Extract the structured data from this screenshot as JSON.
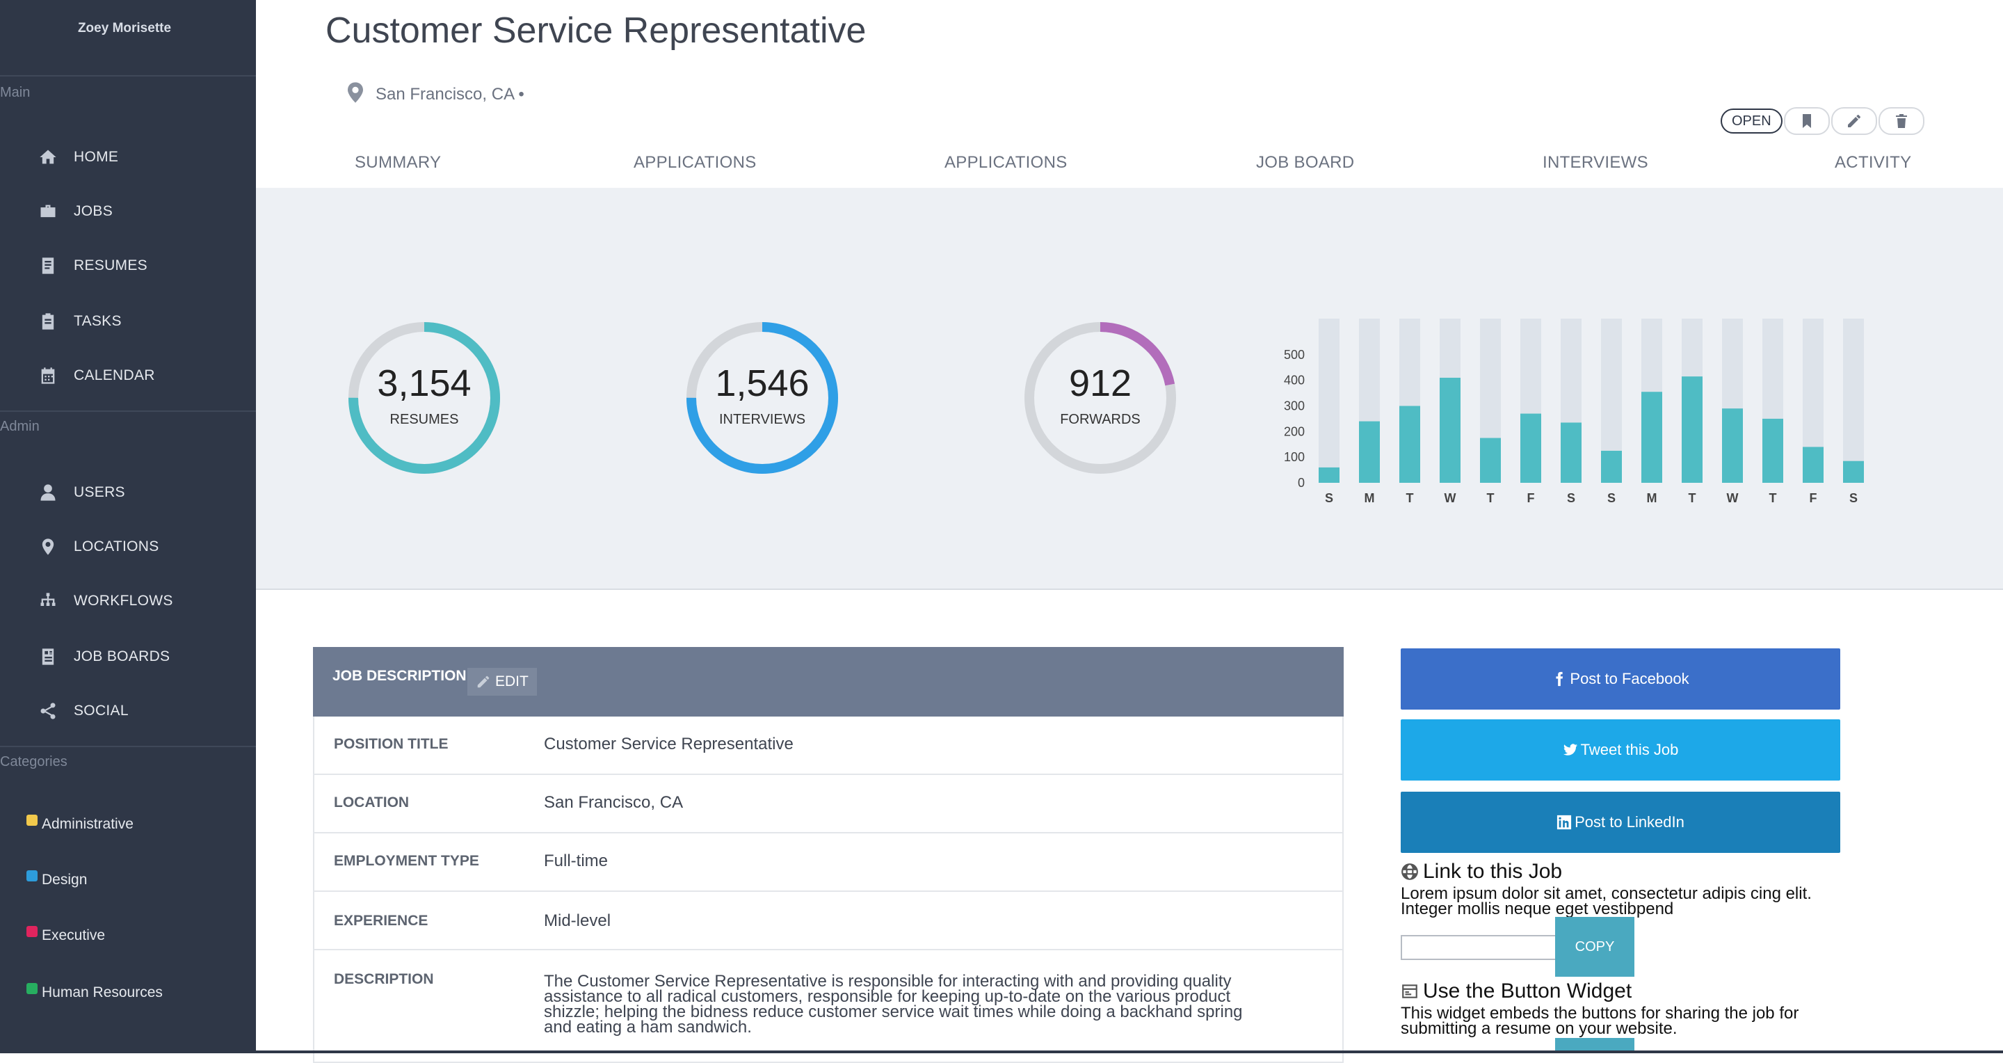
{
  "sidebar": {
    "user_name": "Zoey Morisette",
    "sections": {
      "main": "Main",
      "admin": "Admin",
      "categories": "Categories"
    },
    "main_items": [
      {
        "label": "HOME",
        "icon": "home-icon"
      },
      {
        "label": "JOBS",
        "icon": "briefcase-icon"
      },
      {
        "label": "RESUMES",
        "icon": "document-icon"
      },
      {
        "label": "TASKS",
        "icon": "clipboard-icon"
      },
      {
        "label": "CALENDAR",
        "icon": "calendar-icon"
      }
    ],
    "admin_items": [
      {
        "label": "USERS",
        "icon": "user-icon"
      },
      {
        "label": "LOCATIONS",
        "icon": "map-pin-icon"
      },
      {
        "label": "WORKFLOWS",
        "icon": "workflow-icon"
      },
      {
        "label": "JOB BOARDS",
        "icon": "job-board-icon"
      },
      {
        "label": "SOCIAL",
        "icon": "share-icon"
      }
    ],
    "categories": [
      {
        "label": "Administrative",
        "color": "#f2c94c"
      },
      {
        "label": "Design",
        "color": "#2d9cdb"
      },
      {
        "label": "Executive",
        "color": "#e0245e"
      },
      {
        "label": "Human Resources",
        "color": "#27ae60"
      }
    ]
  },
  "header": {
    "title": "Customer Service Representative",
    "location": "San Francisco, CA •",
    "status": "OPEN",
    "action_icons": [
      "bookmark-icon",
      "pencil-icon",
      "trash-icon"
    ],
    "tabs": [
      "SUMMARY",
      "APPLICATIONS",
      "APPLICATIONS",
      "JOB BOARD",
      "INTERVIEWS",
      "ACTIVITY"
    ]
  },
  "stats": [
    {
      "value": "3,154",
      "label": "RESUMES",
      "fraction": 0.75,
      "color": "#4fbcc4"
    },
    {
      "value": "1,546",
      "label": "INTERVIEWS",
      "fraction": 0.75,
      "color": "#2f9fe6"
    },
    {
      "value": "912",
      "label": "FORWARDS",
      "fraction": 0.22,
      "color": "#b26dbb"
    }
  ],
  "chart_data": {
    "type": "bar",
    "categories": [
      "S",
      "M",
      "T",
      "W",
      "T",
      "F",
      "S",
      "S",
      "M",
      "T",
      "W",
      "T",
      "F",
      "S"
    ],
    "values": [
      60,
      240,
      300,
      410,
      175,
      270,
      235,
      125,
      355,
      415,
      290,
      250,
      140,
      85
    ],
    "yticks": [
      0,
      100,
      200,
      300,
      400,
      500
    ],
    "ylim": [
      0,
      560
    ],
    "bar_color": "#4fbcc4",
    "track_color": "#dde3ea"
  },
  "job_description": {
    "header": "JOB DESCRIPTION",
    "edit_label": "EDIT",
    "rows": [
      {
        "key": "POSITION TITLE",
        "value": "Customer Service Representative"
      },
      {
        "key": "LOCATION",
        "value": "San Francisco, CA"
      },
      {
        "key": "EMPLOYMENT TYPE",
        "value": "Full-time"
      },
      {
        "key": "EXPERIENCE",
        "value": "Mid-level"
      },
      {
        "key": "DESCRIPTION",
        "value": "The Customer Service Representative is responsible for interacting with and providing quality assistance to all radical customers, responsible for keeping up-to-date on the various product shizzle; helping the bidness reduce customer service wait times while doing a backhand spring and eating a ham sandwich."
      }
    ]
  },
  "share": {
    "facebook": {
      "label": "Post to Facebook",
      "color": "#3b6fc9"
    },
    "twitter": {
      "label": "Tweet this Job",
      "color": "#1da8e8"
    },
    "linkedin": {
      "label": "Post to LinkedIn",
      "color": "#1a7fb8"
    },
    "link_title": "Link to this Job",
    "link_text": "Lorem ipsum dolor sit amet, consectetur adipis cing elit. Integer mollis neque eget vestibpend",
    "link_value": "",
    "copy_label": "COPY",
    "widget_title": "Use the Button Widget",
    "widget_text": "This widget embeds the buttons for sharing the job for submitting a resume on your website."
  }
}
